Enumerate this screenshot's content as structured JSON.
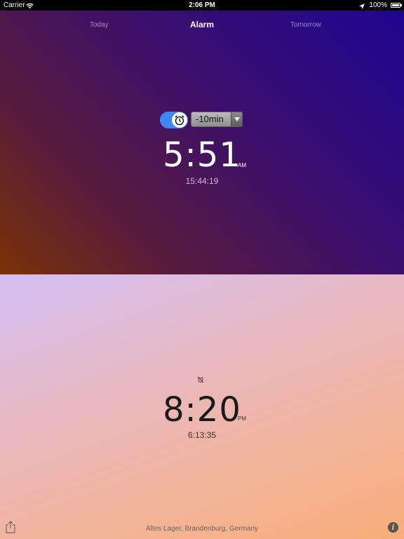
{
  "status_bar": {
    "carrier": "Carrier",
    "time": "2:06 PM",
    "battery": "100%"
  },
  "nav": {
    "tabs": [
      {
        "label": "Today"
      },
      {
        "label": "Alarm"
      },
      {
        "label": "Tomorrow"
      }
    ],
    "active": "Alarm"
  },
  "alarm": {
    "enabled": true,
    "offset": "-10min",
    "time": "5:51",
    "ampm": "AM",
    "countdown": "15:44:19"
  },
  "second": {
    "time": "8:20",
    "ampm": "PM",
    "countdown": "6:13:35"
  },
  "footer": {
    "location": "Altes Lager, Brandenburg, Germany",
    "info_label": "i"
  },
  "colors": {
    "top_gradient_start": "#1e0590",
    "top_gradient_end": "#7a3305",
    "toggle_on": "#3f87f5",
    "bottom_gradient_start": "#d3bff5",
    "bottom_gradient_end": "#f8ad7a"
  },
  "icons": [
    "wifi-icon",
    "location-arrow-icon",
    "battery-icon",
    "alarm-clock-icon",
    "dropdown-arrow-icon",
    "alarm-off-icon",
    "share-icon",
    "info-icon"
  ]
}
